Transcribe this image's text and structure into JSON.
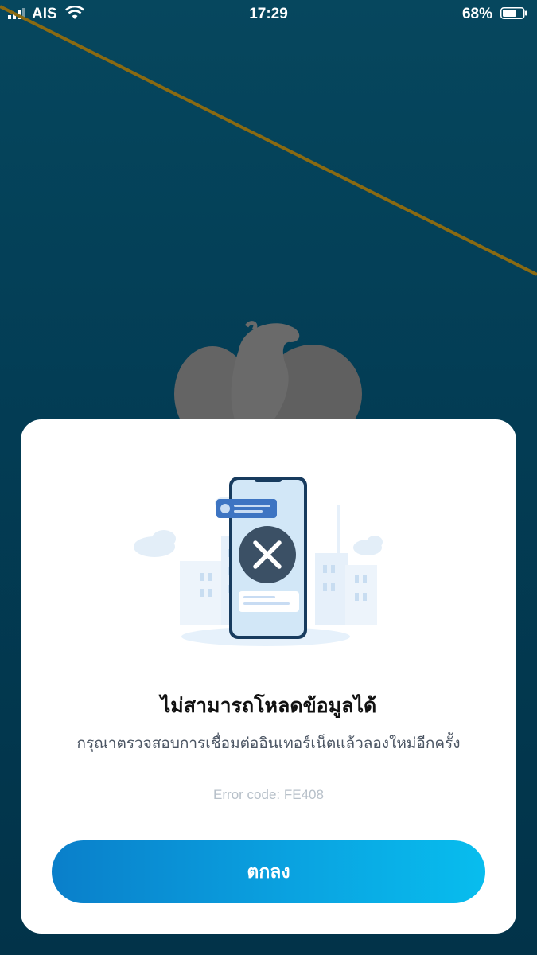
{
  "status_bar": {
    "carrier": "AIS",
    "time": "17:29",
    "battery_percent": "68%",
    "battery_level": 0.68,
    "signal_icon": "signal-bars-icon",
    "wifi_icon": "wifi-icon",
    "battery_icon": "battery-icon"
  },
  "dialog": {
    "illustration": "connection-error-phone-illustration",
    "title": "ไม่สามารถโหลดข้อมูลได้",
    "message": "กรุณาตรวจสอบการเชื่อมต่ออินเทอร์เน็ตแล้วลองใหม่อีกครั้ง",
    "error_code": "Error code: FE408",
    "button_label": "ตกลง"
  },
  "colors": {
    "background": "#033d55",
    "button_start": "#0a7fca",
    "button_end": "#08bdee",
    "accent_line": "#8a6a12",
    "title_text": "#111111",
    "message_text": "#4b5563",
    "error_text": "#b7c0c9"
  }
}
